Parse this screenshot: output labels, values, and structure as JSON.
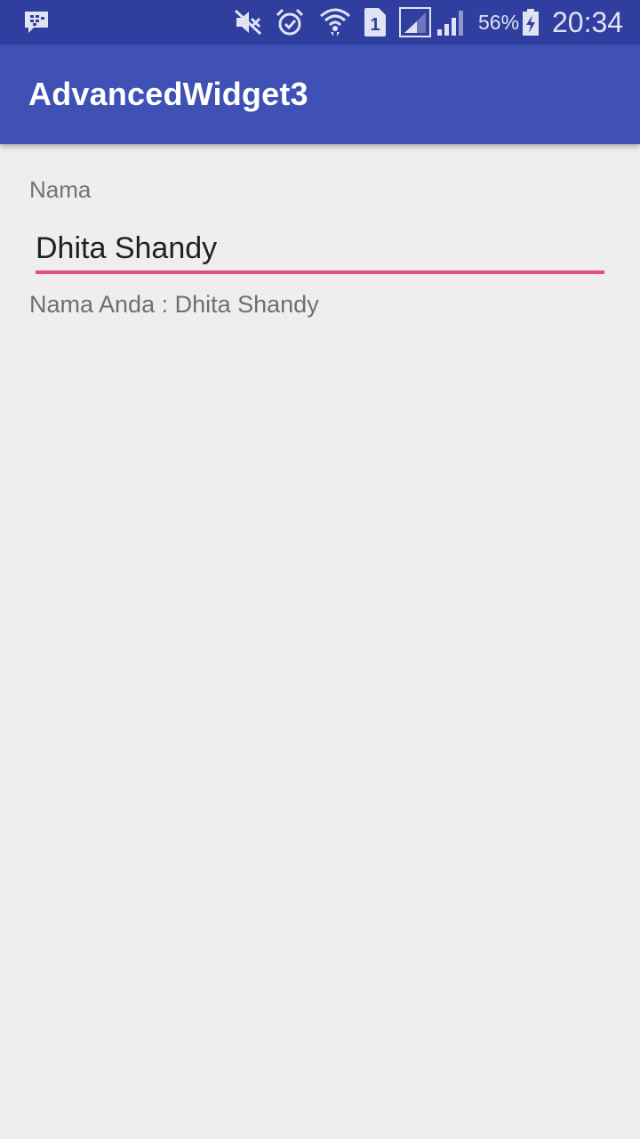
{
  "status_bar": {
    "battery_percent": "56%",
    "time": "20:34",
    "sim_slot": "1",
    "icons": [
      "bbm-icon",
      "mute-icon",
      "alarm-icon",
      "wifi-icon",
      "sim-1-icon",
      "signal-icon",
      "signal-2-icon",
      "battery-charging-icon"
    ]
  },
  "app_bar": {
    "title": "AdvancedWidget3",
    "color": "#3f51b5",
    "status_color": "#303f9f"
  },
  "form": {
    "label": "Nama",
    "input_value": "Dhita Shandy",
    "accent_color": "#e64a7b",
    "result_text": "Nama Anda : Dhita Shandy"
  }
}
